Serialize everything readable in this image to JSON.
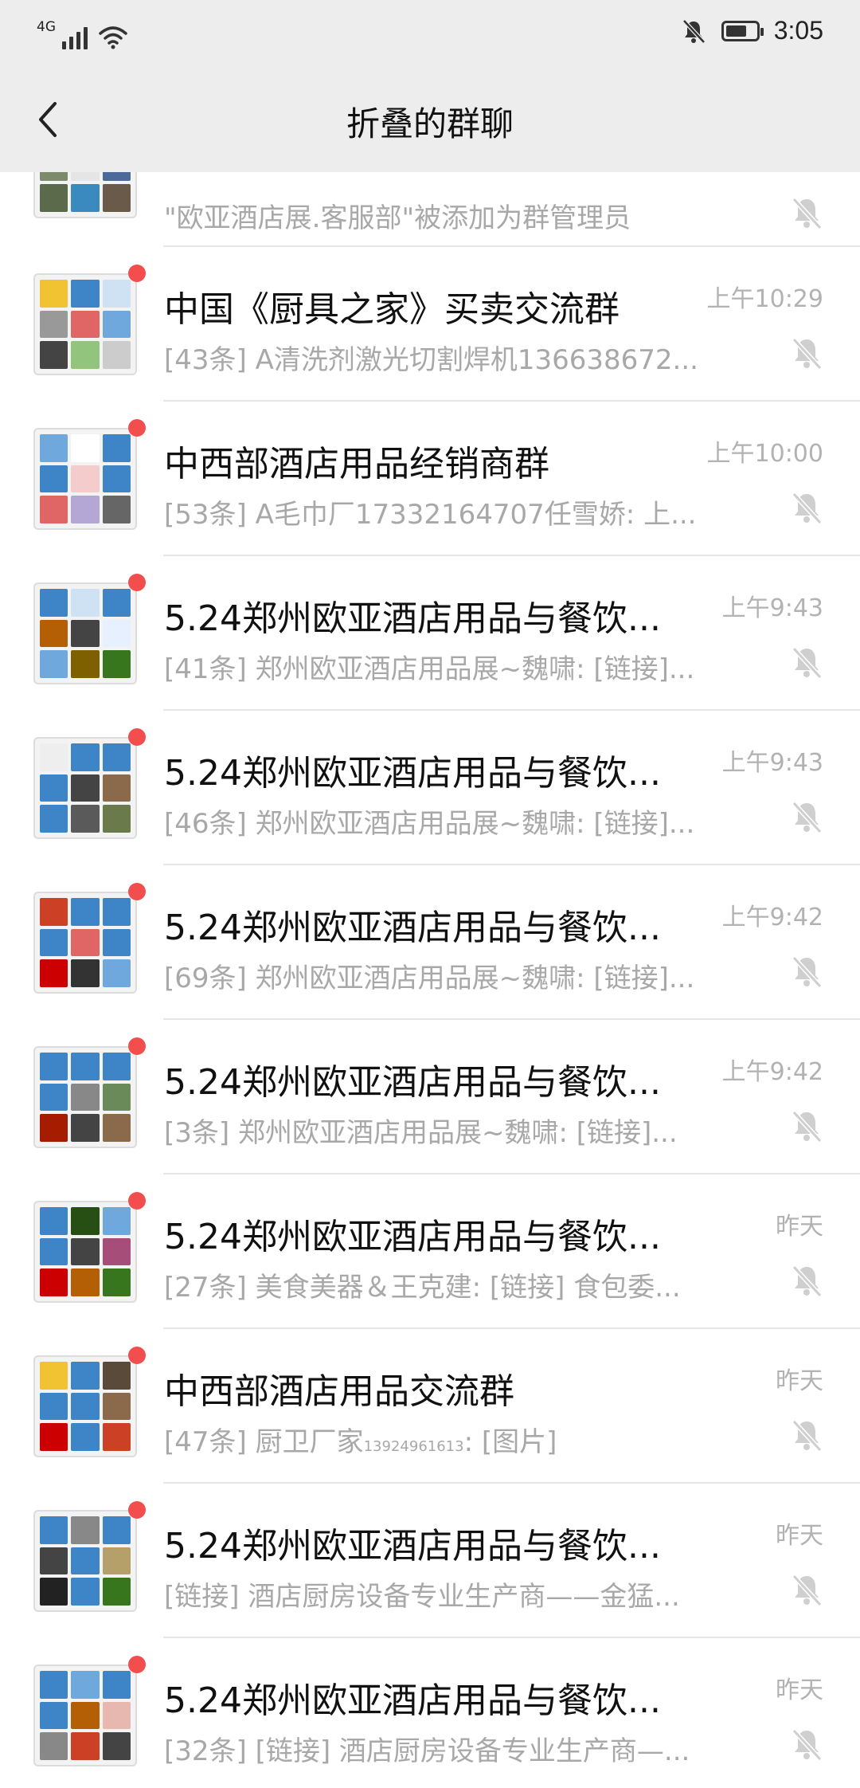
{
  "status_bar": {
    "network": "4G",
    "time": "3:05",
    "battery_level": 0.75
  },
  "nav": {
    "title": "折叠的群聊"
  },
  "partial_row": {
    "preview": "\"欧亚酒店展.客服部\"被添加为群管理员"
  },
  "chats": [
    {
      "title": "中国《厨具之家》买卖交流群",
      "time": "上午10:29",
      "preview": "[43条] A清洗剂激光切割焊机136638672..."
    },
    {
      "title": "中西部酒店用品经销商群",
      "time": "上午10:00",
      "preview": "[53条] A毛巾厂17332164707任雪娇: 上..."
    },
    {
      "title": "5.24郑州欧亚酒店用品与餐饮...",
      "time": "上午9:43",
      "preview": "[41条] 郑州欧亚酒店用品展~魏啸: [链接]..."
    },
    {
      "title": "5.24郑州欧亚酒店用品与餐饮...",
      "time": "上午9:43",
      "preview": "[46条] 郑州欧亚酒店用品展~魏啸: [链接]..."
    },
    {
      "title": "5.24郑州欧亚酒店用品与餐饮...",
      "time": "上午9:42",
      "preview": "[69条] 郑州欧亚酒店用品展~魏啸: [链接]..."
    },
    {
      "title": "5.24郑州欧亚酒店用品与餐饮...",
      "time": "上午9:42",
      "preview": "[3条] 郑州欧亚酒店用品展~魏啸: [链接]..."
    },
    {
      "title": "5.24郑州欧亚酒店用品与餐饮...",
      "time": "昨天",
      "preview": "[27条] 美食美器＆王克建: [链接] 食包委..."
    },
    {
      "title": "中西部酒店用品交流群",
      "time": "昨天",
      "preview_main": "[47条] 厨卫厂家",
      "preview_sub": "13924961613",
      "preview_tail": ": [图片]"
    },
    {
      "title": "5.24郑州欧亚酒店用品与餐饮...",
      "time": "昨天",
      "preview": "[链接] 酒店厨房设备专业生产商——金猛..."
    },
    {
      "title": "5.24郑州欧亚酒店用品与餐饮...",
      "time": "昨天",
      "preview": "[32条] [链接] 酒店厨房设备专业生产商—..."
    }
  ],
  "colors": {
    "unread_dot": "#f24e4e",
    "header_bg": "#ededed",
    "muted_text": "#a8a8a8"
  }
}
